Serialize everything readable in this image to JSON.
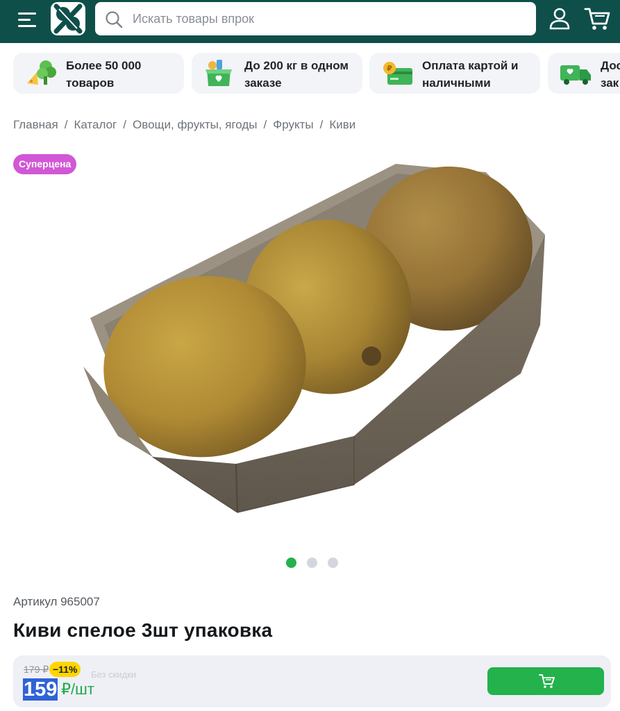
{
  "header": {
    "search_placeholder": "Искать товары впрок"
  },
  "features": [
    {
      "text": "Более 50 000\nтоваров",
      "icon": "vegetables-icon"
    },
    {
      "text": "До 200 кг в одном\nзаказе",
      "icon": "groceries-box-icon"
    },
    {
      "text": "Оплата картой и\nналичными",
      "icon": "card-coin-icon"
    },
    {
      "text": "Дос\nзак",
      "icon": "delivery-truck-icon"
    }
  ],
  "breadcrumb": [
    "Главная",
    "Каталог",
    "Овощи, фрукты, ягоды",
    "Фрукты",
    "Киви"
  ],
  "badge": "Суперцена",
  "gallery": {
    "total": 3,
    "active": 1
  },
  "product": {
    "article": "Артикул 965007",
    "title": "Киви спелое 3шт упаковка",
    "old_price": "179 ₽",
    "discount": "−11%",
    "faded_note": "Без скидки",
    "price": "159",
    "unit": " ₽/шт"
  },
  "colors": {
    "header": "#0f4f4a",
    "accent_green": "#23b24b",
    "badge": "#d257d6",
    "discount": "#ffd600",
    "price_highlight": "#2f63d6"
  }
}
